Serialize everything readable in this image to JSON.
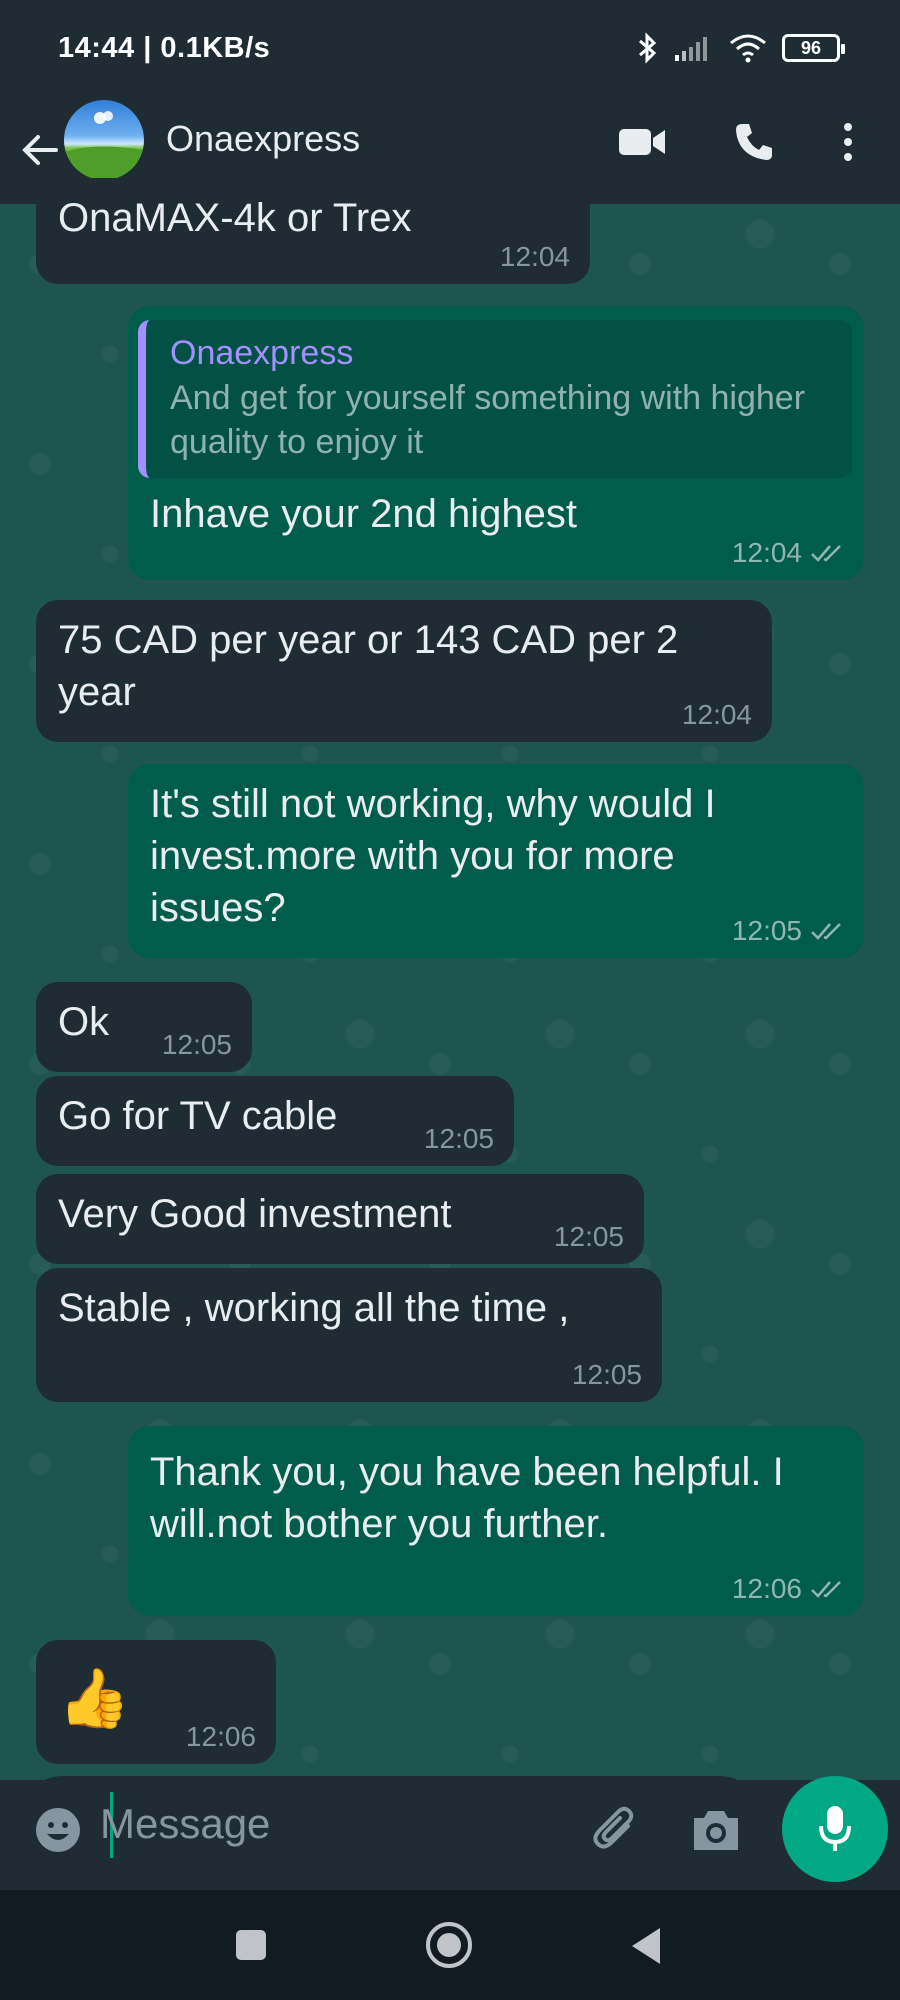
{
  "status_bar": {
    "time": "14:44 | 0.1KB/s",
    "battery": "96"
  },
  "header": {
    "contact_name": "Onaexpress"
  },
  "messages": [
    {
      "dir": "in",
      "text": "OnaMAX-4k or Trex",
      "time": "12:04"
    },
    {
      "dir": "out",
      "quote_name": "Onaexpress",
      "quote_text": "And get for yourself something with higher quality to enjoy it",
      "text": "Inhave your 2nd highest",
      "time": "12:04"
    },
    {
      "dir": "in",
      "text": "75 CAD per year or 143 CAD per 2 year",
      "time": "12:04"
    },
    {
      "dir": "out",
      "text": "It's still not working, why would I invest.more with you for more issues?",
      "time": "12:05"
    },
    {
      "dir": "in",
      "text": "Ok",
      "time": "12:05"
    },
    {
      "dir": "in",
      "text": "Go for TV cable",
      "time": "12:05"
    },
    {
      "dir": "in",
      "text": "Very Good investment",
      "time": "12:05"
    },
    {
      "dir": "in",
      "text": "Stable , working all the time ,",
      "time": "12:05"
    },
    {
      "dir": "out",
      "text": "Thank you, you have been helpful. I will.not bother you further.",
      "time": "12:06"
    },
    {
      "dir": "in",
      "text": "👍",
      "time": "12:06"
    }
  ],
  "input": {
    "placeholder": "Message"
  },
  "colors": {
    "outgoing": "#005c4b",
    "incoming": "#202c33",
    "accent": "#00a884",
    "quote_bar": "#a290ff"
  },
  "icons": [
    "back-arrow-icon",
    "video-call-icon",
    "phone-call-icon",
    "more-vert-icon",
    "emoji-icon",
    "attach-icon",
    "camera-icon",
    "mic-icon",
    "read-receipt-icon",
    "recents-icon",
    "home-icon",
    "back-icon"
  ]
}
